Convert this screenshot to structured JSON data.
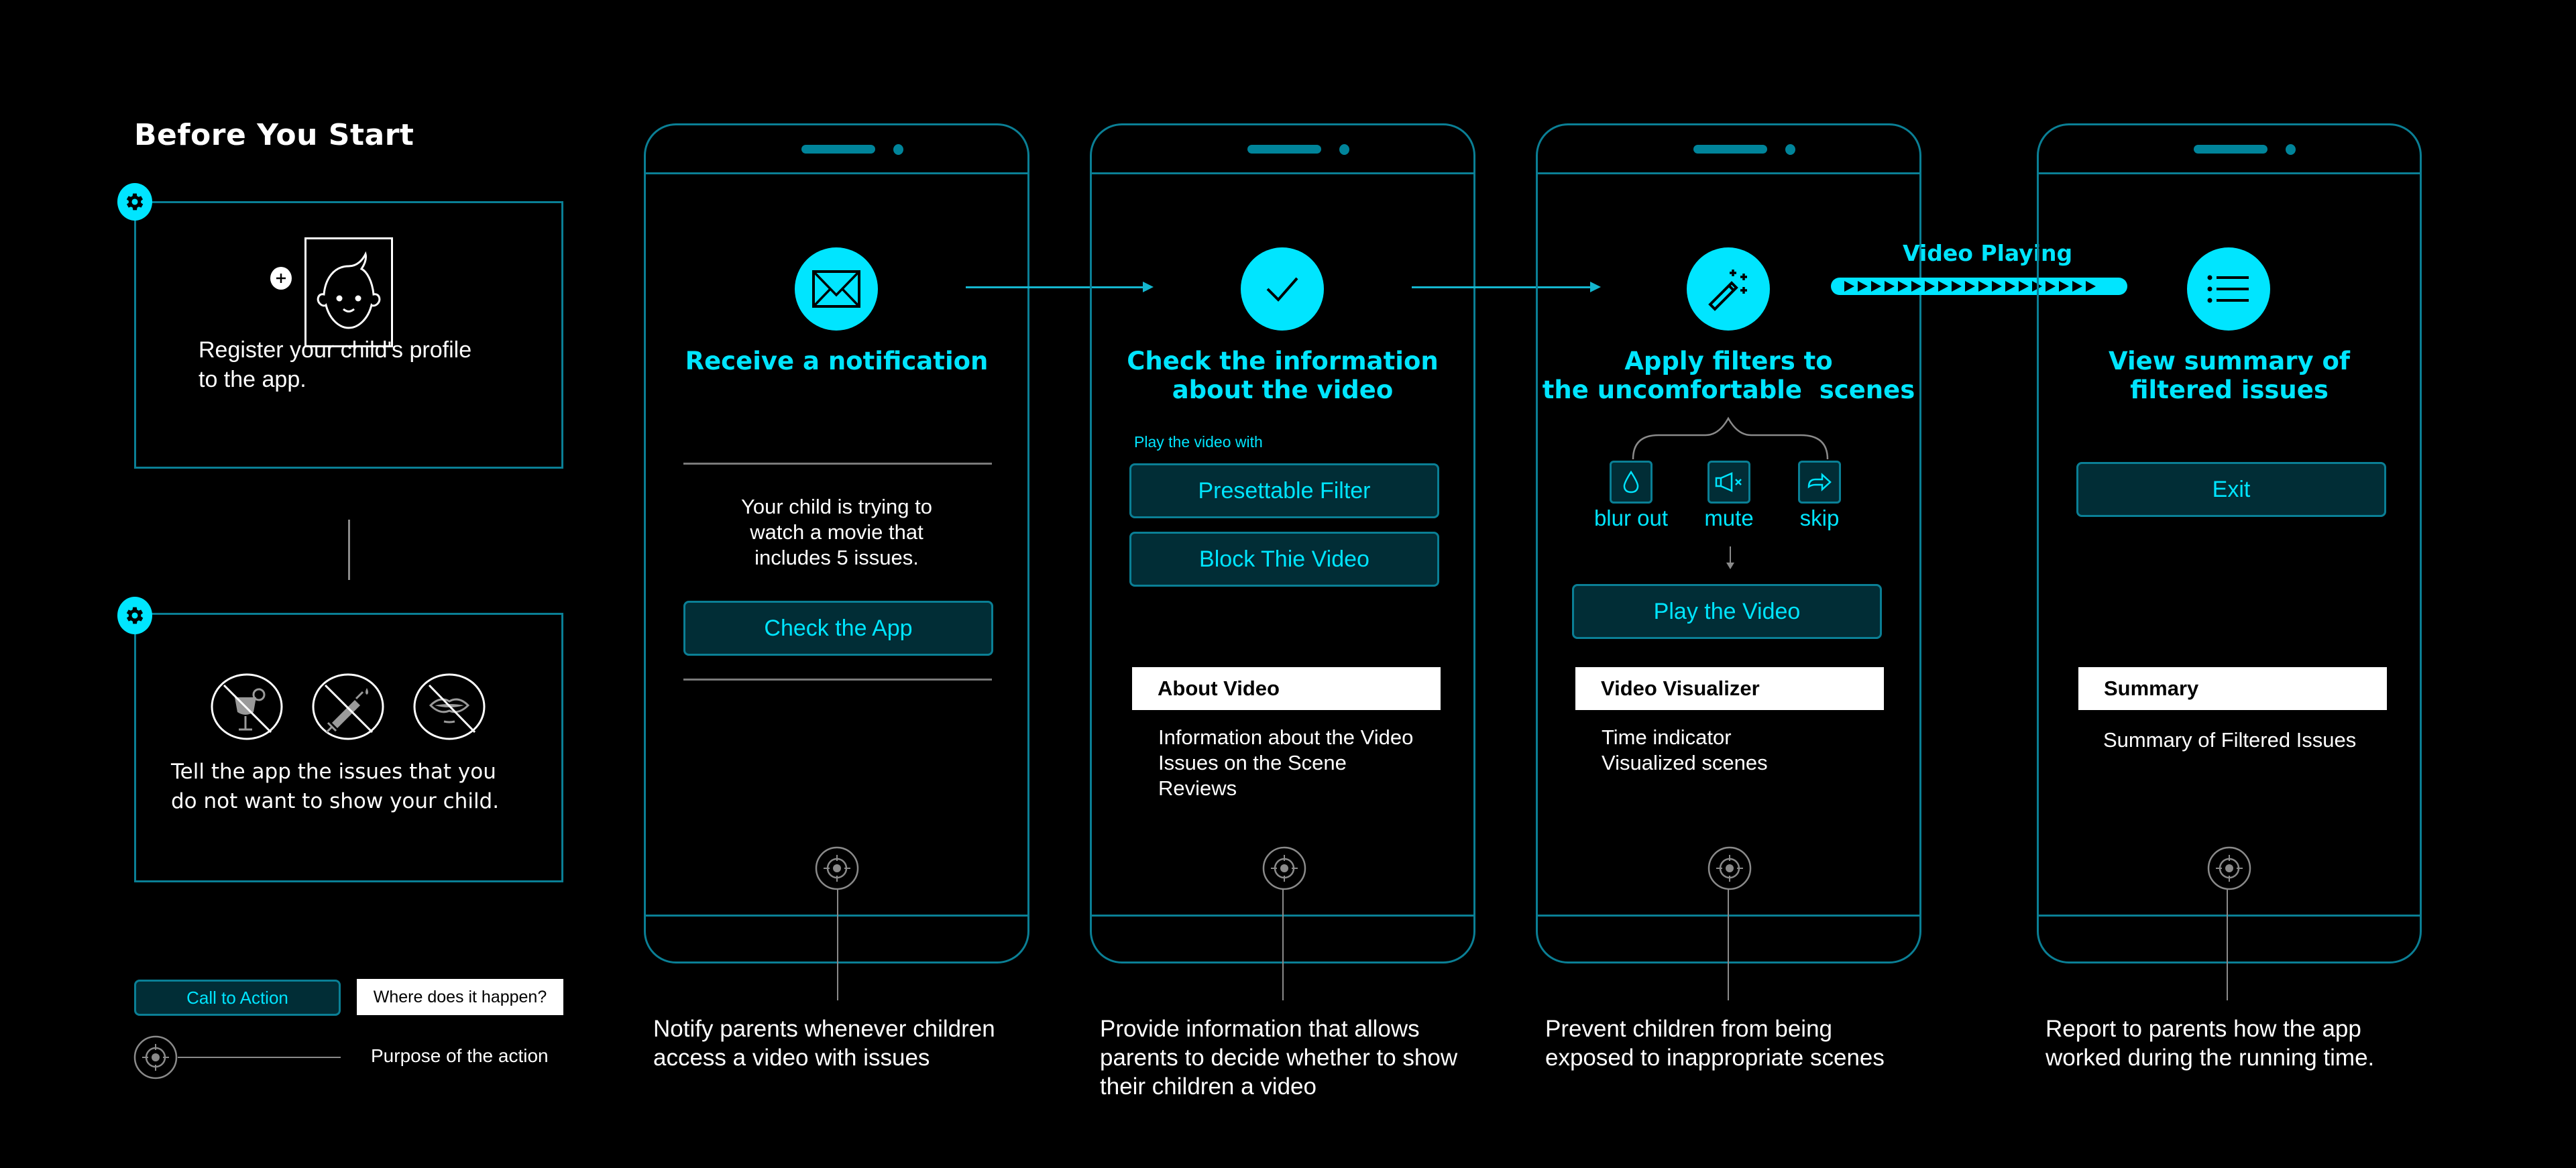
{
  "colors": {
    "accent": "#00e5ff",
    "frame": "#0a7f95",
    "button_bg": "#012d36",
    "neutral_line": "#8a8a8a",
    "background": "#000000"
  },
  "before_start": {
    "title": "Before You Start",
    "step1": {
      "icon": "gear-icon",
      "illustration": "child-face-icon",
      "add_icon": "plus-circle-icon",
      "text_line1": "Register your child's profile",
      "text_line2": "to the app."
    },
    "step2": {
      "icon": "gear-icon",
      "issue_icons": [
        "no-alcohol-icon",
        "no-drugs-icon",
        "no-sexual-content-icon"
      ],
      "text_line1": "Tell the app the issues that you",
      "text_line2": "do not want to show your child."
    }
  },
  "legend": {
    "cta_label": "Call to Action",
    "where_label": "Where does it happen?",
    "purpose_label": "Purpose of the action",
    "purpose_icon": "target-icon"
  },
  "phones": [
    {
      "icon": "envelope-icon",
      "title_line1": "Receive a notification",
      "title_line2": "",
      "message_lines": [
        "Your child is trying to",
        "watch a movie that",
        "includes 5 issues."
      ],
      "button": "Check the App",
      "caption_lines": [
        "Notify parents whenever children",
        "access a video with issues"
      ]
    },
    {
      "icon": "checkmark-icon",
      "title_line1": "Check the information",
      "title_line2": "about the video",
      "subtitle": "Play the video with",
      "buttons": [
        "Presettable Filter",
        "Block Thie Video"
      ],
      "section_header": "About Video",
      "section_lines": [
        "Information about the Video",
        "Issues on the Scene",
        "Reviews"
      ],
      "caption_lines": [
        "Provide information that allows",
        "parents to decide whether to show",
        "their children a video"
      ]
    },
    {
      "icon": "magic-wand-icon",
      "title_line1": "Apply filters to",
      "title_line2": "the uncomfortable  scenes",
      "filters": [
        {
          "label": "blur out",
          "icon": "droplet-icon"
        },
        {
          "label": "mute",
          "icon": "speaker-mute-icon"
        },
        {
          "label": "skip",
          "icon": "skip-arrow-icon"
        }
      ],
      "button": "Play the Video",
      "section_header": "Video Visualizer",
      "section_lines": [
        "Time indicator",
        "Visualized scenes"
      ],
      "caption_lines": [
        "Prevent children from being",
        "exposed to inappropriate scenes"
      ]
    },
    {
      "icon": "list-icon",
      "title_line1": "View summary of",
      "title_line2": "filtered issues",
      "button": "Exit",
      "section_header": "Summary",
      "section_lines": [
        "Summary of Filtered Issues"
      ],
      "caption_lines": [
        "Report to parents how the app",
        "worked during the running time."
      ]
    }
  ],
  "video_playing": {
    "label": "Video Playing",
    "marker_count": 19
  }
}
